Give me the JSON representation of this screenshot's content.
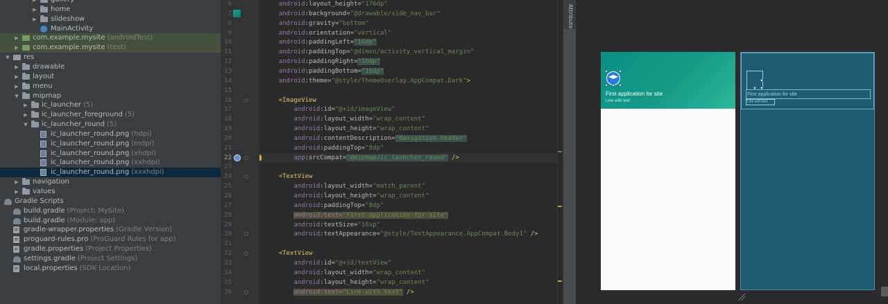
{
  "project_tree": [
    {
      "indent": 3,
      "arrow": "right",
      "icon": "folder",
      "label": "gallery",
      "hint": ""
    },
    {
      "indent": 3,
      "arrow": "right",
      "icon": "folder",
      "label": "home",
      "hint": ""
    },
    {
      "indent": 3,
      "arrow": "right",
      "icon": "folder",
      "label": "slideshow",
      "hint": ""
    },
    {
      "indent": 3,
      "arrow": "",
      "icon": "class",
      "label": "MainActivity",
      "hint": ""
    },
    {
      "indent": 1,
      "arrow": "right",
      "icon": "package-green",
      "label": "com.example.mysite",
      "hint": "(androidTest)",
      "state": "green"
    },
    {
      "indent": 1,
      "arrow": "right",
      "icon": "package-green",
      "label": "com.example.mysite",
      "hint": "(test)",
      "state": "green"
    },
    {
      "indent": 0,
      "arrow": "down",
      "icon": "res",
      "label": "res",
      "hint": ""
    },
    {
      "indent": 1,
      "arrow": "right",
      "icon": "folder",
      "label": "drawable",
      "hint": ""
    },
    {
      "indent": 1,
      "arrow": "right",
      "icon": "folder",
      "label": "layout",
      "hint": ""
    },
    {
      "indent": 1,
      "arrow": "right",
      "icon": "folder",
      "label": "menu",
      "hint": ""
    },
    {
      "indent": 1,
      "arrow": "down",
      "icon": "folder",
      "label": "mipmap",
      "hint": ""
    },
    {
      "indent": 2,
      "arrow": "right",
      "icon": "folder",
      "label": "ic_launcher",
      "hint": "(5)"
    },
    {
      "indent": 2,
      "arrow": "right",
      "icon": "folder",
      "label": "ic_launcher_foreground",
      "hint": "(5)"
    },
    {
      "indent": 2,
      "arrow": "down",
      "icon": "folder",
      "label": "ic_launcher_round",
      "hint": "(5)"
    },
    {
      "indent": 3,
      "arrow": "",
      "icon": "image",
      "label": "ic_launcher_round.png",
      "hint": "(hdpi)"
    },
    {
      "indent": 3,
      "arrow": "",
      "icon": "image",
      "label": "ic_launcher_round.png",
      "hint": "(mdpi)"
    },
    {
      "indent": 3,
      "arrow": "",
      "icon": "image",
      "label": "ic_launcher_round.png",
      "hint": "(xhdpi)"
    },
    {
      "indent": 3,
      "arrow": "",
      "icon": "image",
      "label": "ic_launcher_round.png",
      "hint": "(xxhdpi)"
    },
    {
      "indent": 3,
      "arrow": "",
      "icon": "image",
      "label": "ic_launcher_round.png",
      "hint": "(xxxhdpi)",
      "state": "selected"
    },
    {
      "indent": 1,
      "arrow": "right",
      "icon": "folder",
      "label": "navigation",
      "hint": ""
    },
    {
      "indent": 1,
      "arrow": "right",
      "icon": "folder",
      "label": "values",
      "hint": ""
    },
    {
      "indent": -1,
      "arrow": "down",
      "icon": "gradle",
      "label": "Gradle Scripts",
      "hint": ""
    },
    {
      "indent": 0,
      "arrow": "",
      "icon": "gradle",
      "label": "build.gradle",
      "hint": "(Project: MySite)"
    },
    {
      "indent": 0,
      "arrow": "",
      "icon": "gradle",
      "label": "build.gradle",
      "hint": "(Module: app)"
    },
    {
      "indent": 0,
      "arrow": "",
      "icon": "props",
      "label": "gradle-wrapper.properties",
      "hint": "(Gradle Version)"
    },
    {
      "indent": 0,
      "arrow": "",
      "icon": "props",
      "label": "proguard-rules.pro",
      "hint": "(ProGuard Rules for app)"
    },
    {
      "indent": 0,
      "arrow": "",
      "icon": "props",
      "label": "gradle.properties",
      "hint": "(Project Properties)"
    },
    {
      "indent": 0,
      "arrow": "",
      "icon": "gradle",
      "label": "settings.gradle",
      "hint": "(Project Settings)"
    },
    {
      "indent": 0,
      "arrow": "",
      "icon": "props",
      "label": "local.properties",
      "hint": "(SDK Location)"
    }
  ],
  "editor": {
    "current_line": 22,
    "lines": [
      {
        "n": 6,
        "fold": false,
        "tokens": [
          [
            "i1",
            ""
          ],
          [
            "ns",
            "android"
          ],
          [
            "attr",
            ":layout_height="
          ],
          [
            "val",
            "\"176dp\""
          ]
        ]
      },
      {
        "n": 7,
        "fold": false,
        "tokens": [
          [
            "i1",
            ""
          ],
          [
            "ns",
            "android"
          ],
          [
            "attr",
            ":background="
          ],
          [
            "val",
            "\"@drawable/side_nav_bar\""
          ]
        ]
      },
      {
        "n": 8,
        "fold": false,
        "tokens": [
          [
            "i1",
            ""
          ],
          [
            "ns",
            "android"
          ],
          [
            "attr",
            ":gravity="
          ],
          [
            "val",
            "\"bottom\""
          ]
        ]
      },
      {
        "n": 9,
        "fold": false,
        "tokens": [
          [
            "i1",
            ""
          ],
          [
            "ns",
            "android"
          ],
          [
            "attr",
            ":orientation="
          ],
          [
            "val",
            "\"vertical\""
          ]
        ]
      },
      {
        "n": 10,
        "fold": false,
        "tokens": [
          [
            "i1",
            ""
          ],
          [
            "ns",
            "android"
          ],
          [
            "attr",
            ":paddingLeft="
          ],
          [
            "hlval",
            "\"16dp\""
          ]
        ]
      },
      {
        "n": 11,
        "fold": false,
        "tokens": [
          [
            "i1",
            ""
          ],
          [
            "ns",
            "android"
          ],
          [
            "attr",
            ":paddingTop="
          ],
          [
            "val",
            "\"@dimen/activity_vertical_margin\""
          ]
        ]
      },
      {
        "n": 12,
        "fold": false,
        "tokens": [
          [
            "i1",
            ""
          ],
          [
            "ns",
            "android"
          ],
          [
            "attr",
            ":paddingRight="
          ],
          [
            "hlval",
            "\"16dp\""
          ]
        ]
      },
      {
        "n": 13,
        "fold": false,
        "tokens": [
          [
            "i1",
            ""
          ],
          [
            "ns",
            "android"
          ],
          [
            "attr",
            ":paddingBottom="
          ],
          [
            "hlval",
            "\"16dp\""
          ]
        ]
      },
      {
        "n": 14,
        "fold": false,
        "tokens": [
          [
            "i1",
            ""
          ],
          [
            "ns",
            "android"
          ],
          [
            "attr",
            ":theme="
          ],
          [
            "val",
            "\"@style/ThemeOverlay.AppCompat.Dark\""
          ],
          [
            "punct",
            ">"
          ]
        ]
      },
      {
        "n": 15,
        "fold": false,
        "tokens": []
      },
      {
        "n": 16,
        "fold": true,
        "tokens": [
          [
            "i1",
            ""
          ],
          [
            "punct",
            "<"
          ],
          [
            "tag",
            "ImageView"
          ]
        ]
      },
      {
        "n": 17,
        "fold": false,
        "tokens": [
          [
            "i2",
            ""
          ],
          [
            "ns",
            "android"
          ],
          [
            "attr",
            ":id="
          ],
          [
            "val",
            "\"@+id/imageView\""
          ]
        ]
      },
      {
        "n": 18,
        "fold": false,
        "tokens": [
          [
            "i2",
            ""
          ],
          [
            "ns",
            "android"
          ],
          [
            "attr",
            ":layout_width="
          ],
          [
            "val",
            "\"wrap_content\""
          ]
        ]
      },
      {
        "n": 19,
        "fold": false,
        "tokens": [
          [
            "i2",
            ""
          ],
          [
            "ns",
            "android"
          ],
          [
            "attr",
            ":layout_height="
          ],
          [
            "val",
            "\"wrap_content\""
          ]
        ]
      },
      {
        "n": 20,
        "fold": false,
        "tokens": [
          [
            "i2",
            ""
          ],
          [
            "ns",
            "android"
          ],
          [
            "attr",
            ":contentDescription="
          ],
          [
            "hlval",
            "\"Navigation header\""
          ]
        ]
      },
      {
        "n": 21,
        "fold": false,
        "tokens": [
          [
            "i2",
            ""
          ],
          [
            "ns",
            "android"
          ],
          [
            "attr",
            ":paddingTop="
          ],
          [
            "val",
            "\"8dp\""
          ]
        ]
      },
      {
        "n": 22,
        "fold": true,
        "tokens": [
          [
            "i2",
            ""
          ],
          [
            "ns",
            "app"
          ],
          [
            "attr",
            ":srcCompat="
          ],
          [
            "hlval",
            "\"@mipmap/ic_launcher_round\""
          ],
          [
            "punct",
            " />"
          ]
        ]
      },
      {
        "n": 23,
        "fold": false,
        "tokens": []
      },
      {
        "n": 24,
        "fold": true,
        "tokens": [
          [
            "i1",
            ""
          ],
          [
            "punct",
            "<"
          ],
          [
            "tag",
            "TextView"
          ]
        ]
      },
      {
        "n": 25,
        "fold": false,
        "tokens": [
          [
            "i2",
            ""
          ],
          [
            "ns",
            "android"
          ],
          [
            "attr",
            ":layout_width="
          ],
          [
            "val",
            "\"match_parent\""
          ]
        ]
      },
      {
        "n": 26,
        "fold": false,
        "tokens": [
          [
            "i2",
            ""
          ],
          [
            "ns",
            "android"
          ],
          [
            "attr",
            ":layout_height="
          ],
          [
            "val",
            "\"wrap_content\""
          ]
        ]
      },
      {
        "n": 27,
        "fold": false,
        "tokens": [
          [
            "i2",
            ""
          ],
          [
            "ns",
            "android"
          ],
          [
            "attr",
            ":paddingTop="
          ],
          [
            "val",
            "\"8dp\""
          ]
        ]
      },
      {
        "n": 28,
        "fold": false,
        "tokens": [
          [
            "i2",
            ""
          ],
          [
            "hlattr",
            "android:text="
          ],
          [
            "hlattrval",
            "\"First application for site\""
          ]
        ]
      },
      {
        "n": 29,
        "fold": false,
        "tokens": [
          [
            "i2",
            ""
          ],
          [
            "ns",
            "android"
          ],
          [
            "attr",
            ":textSize="
          ],
          [
            "val",
            "\"18sp\""
          ]
        ]
      },
      {
        "n": 30,
        "fold": true,
        "tokens": [
          [
            "i2",
            ""
          ],
          [
            "ns",
            "android"
          ],
          [
            "attr",
            ":textAppearance="
          ],
          [
            "val",
            "\"@style/TextAppearance.AppCompat.Body1\""
          ],
          [
            "punct",
            " />"
          ]
        ]
      },
      {
        "n": 31,
        "fold": false,
        "tokens": []
      },
      {
        "n": 32,
        "fold": true,
        "tokens": [
          [
            "i1",
            ""
          ],
          [
            "punct",
            "<"
          ],
          [
            "tag",
            "TextView"
          ]
        ]
      },
      {
        "n": 33,
        "fold": false,
        "tokens": [
          [
            "i2",
            ""
          ],
          [
            "ns",
            "android"
          ],
          [
            "attr",
            ":id="
          ],
          [
            "val",
            "\"@+id/textView\""
          ]
        ]
      },
      {
        "n": 34,
        "fold": false,
        "tokens": [
          [
            "i2",
            ""
          ],
          [
            "ns",
            "android"
          ],
          [
            "attr",
            ":layout_width="
          ],
          [
            "val",
            "\"wrap_content\""
          ]
        ]
      },
      {
        "n": 35,
        "fold": false,
        "tokens": [
          [
            "i2",
            ""
          ],
          [
            "ns",
            "android"
          ],
          [
            "attr",
            ":layout_height="
          ],
          [
            "val",
            "\"wrap_content\""
          ]
        ]
      },
      {
        "n": 36,
        "fold": true,
        "tokens": [
          [
            "i2",
            ""
          ],
          [
            "hlattr",
            "android:text="
          ],
          [
            "hlattrval",
            "\"Line with text\""
          ],
          [
            "punct",
            " />"
          ]
        ]
      }
    ]
  },
  "side_panel": {
    "tab_label": "Attributes"
  },
  "preview": {
    "title_text": "First application for site",
    "subtitle_text": "Line with text",
    "blueprint_title_text": "First application for site",
    "blueprint_subtitle_text": "Line with text"
  },
  "colors": {
    "header_gradient_start": "#0a8f84",
    "header_gradient_end": "#2db89a",
    "blueprint_bg": "#215a73",
    "selected_row": "#0d293e",
    "test_row": "#45513e"
  }
}
